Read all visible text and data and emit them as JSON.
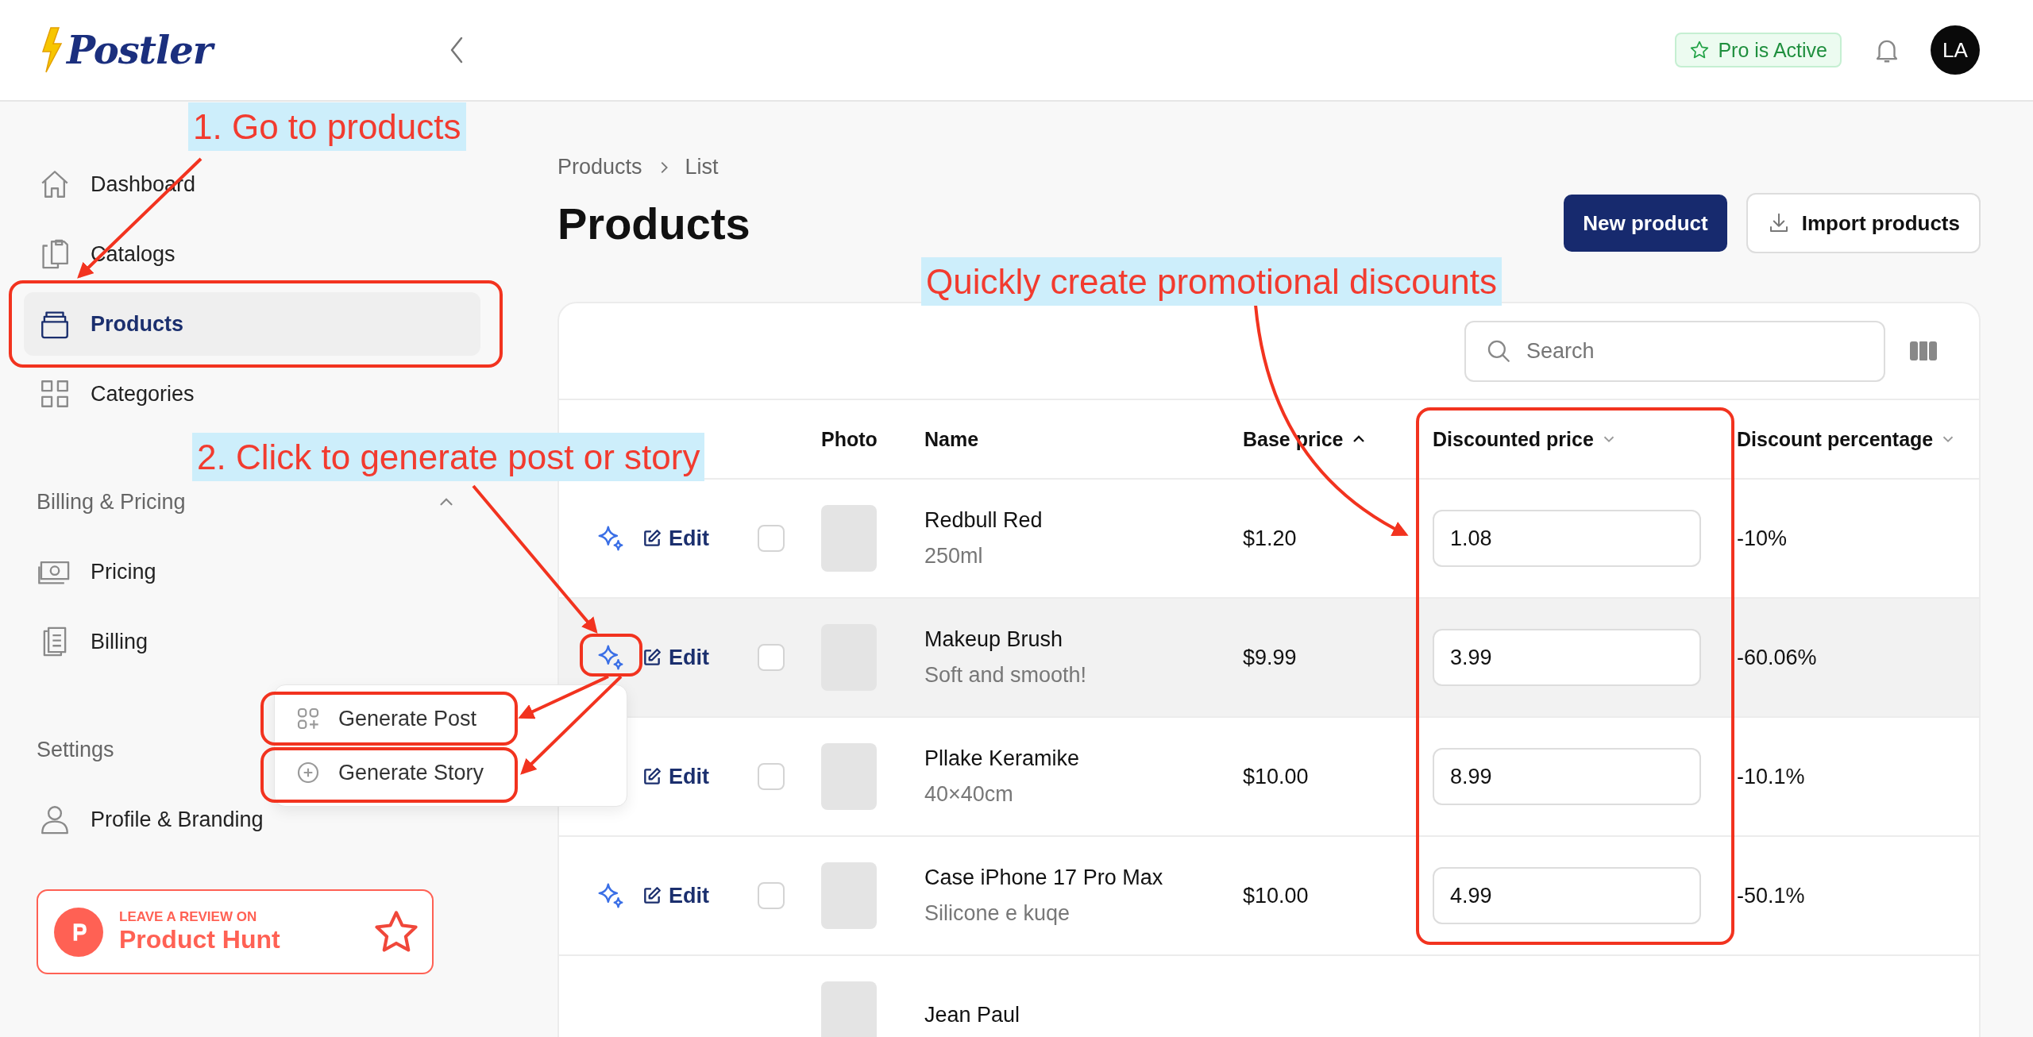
{
  "header": {
    "logo": "Postler",
    "badge": "Pro is Active",
    "avatar": "LA"
  },
  "sidebar": {
    "sections": [
      {
        "items": [
          {
            "label": "Dashboard",
            "selected": false
          },
          {
            "label": "Catalogs",
            "selected": false
          },
          {
            "label": "Products",
            "selected": true
          },
          {
            "label": "Categories",
            "selected": false
          }
        ]
      },
      {
        "title": "Billing & Pricing",
        "expanded": true,
        "items": [
          {
            "label": "Pricing",
            "selected": false
          },
          {
            "label": "Billing",
            "selected": false
          }
        ]
      },
      {
        "title": "Settings",
        "items": [
          {
            "label": "Profile & Branding",
            "selected": false
          }
        ]
      }
    ],
    "review": {
      "kicker": "LEAVE A REVIEW ON",
      "name": "Product Hunt"
    }
  },
  "breadcrumb": [
    "Products",
    "List"
  ],
  "page_title": "Products",
  "actions": {
    "primary": "New product",
    "secondary": "Import products"
  },
  "search": {
    "placeholder": "Search"
  },
  "table": {
    "columns": [
      {
        "label": "Photo"
      },
      {
        "label": "Name"
      },
      {
        "label": "Base price",
        "sorted": true
      },
      {
        "label": "Discounted price",
        "sorted": false
      },
      {
        "label": "Discount percentage",
        "sorted": false
      }
    ],
    "rows": [
      {
        "generate_icon": true,
        "edit": "Edit",
        "checked": false,
        "highlighted": false,
        "name": "Redbull Red",
        "note": "250ml",
        "base_price": "$1.20",
        "discounted_price": "1.08",
        "discount": "-10%"
      },
      {
        "generate_icon": true,
        "edit": "Edit",
        "checked": false,
        "highlighted": true,
        "name": "Makeup Brush",
        "note": "Soft and smooth!",
        "base_price": "$9.99",
        "discounted_price": "3.99",
        "discount": "-60.06%"
      },
      {
        "generate_icon": false,
        "edit": "Edit",
        "checked": false,
        "highlighted": false,
        "name": "Pllake Keramike",
        "note": "40×40cm",
        "base_price": "$10.00",
        "discounted_price": "8.99",
        "discount": "-10.1%"
      },
      {
        "generate_icon": true,
        "edit": "Edit",
        "checked": false,
        "highlighted": false,
        "name": "Case iPhone 17 Pro Max",
        "note": "Silicone e kuqe",
        "base_price": "$10.00",
        "discounted_price": "4.99",
        "discount": "-50.1%"
      },
      {
        "highlighted": false,
        "name": "Jean Paul"
      }
    ]
  },
  "generate_menu": {
    "items": [
      {
        "label": "Generate Post"
      },
      {
        "label": "Generate Story"
      }
    ]
  },
  "annotations": [
    {
      "text": "1. Go to products"
    },
    {
      "text": "2. Click to generate post or story"
    },
    {
      "text": "Quickly create promotional discounts"
    }
  ]
}
